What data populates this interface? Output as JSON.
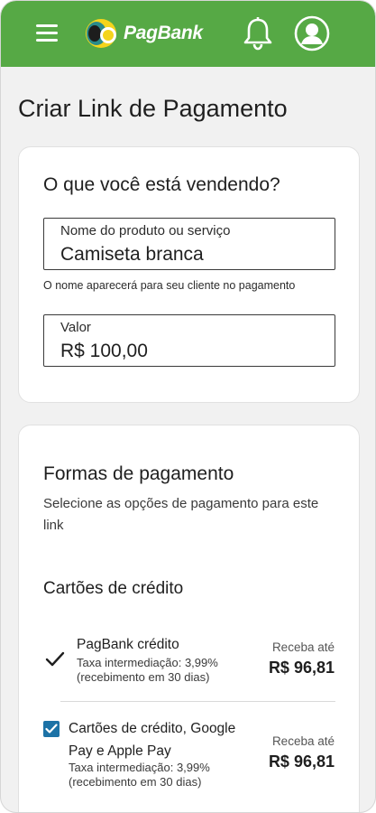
{
  "header": {
    "brand": "PagBank",
    "colors": {
      "bar": "#56a945",
      "logo_yellow": "#f4d41c",
      "logo_teal": "#2a8b8a"
    },
    "icons": {
      "menu": "hamburger-menu-icon",
      "notifications": "bell-icon",
      "profile": "user-avatar-icon"
    }
  },
  "page": {
    "title": "Criar Link de Pagamento"
  },
  "product": {
    "section_title": "O que você está vendendo?",
    "name_field": {
      "label": "Nome do produto ou serviço",
      "value": "Camiseta branca"
    },
    "name_helper": "O nome aparecerá para seu cliente no pagamento",
    "value_field": {
      "label": "Valor",
      "value": "R$ 100,00"
    }
  },
  "payment": {
    "section_title": "Formas de pagamento",
    "description": "Selecione as opções de pagamento para este link",
    "credit_title": "Cartões de crédito",
    "options": [
      {
        "name": "PagBank crédito",
        "fee_line1": "Taxa intermediação: 3,99%",
        "fee_line2": "(recebimento em 30 dias)",
        "receive_label": "Receba até",
        "receive_amount": "R$ 96,81",
        "selected": true,
        "control": "checkmark-icon"
      },
      {
        "name": "Cartões de crédito, Google Pay e Apple Pay",
        "fee_line1": "Taxa intermediação: 3,99%",
        "fee_line2": "(recebimento em 30 dias)",
        "receive_label": "Receba até",
        "receive_amount": "R$ 96,81",
        "selected": true,
        "control": "checkbox",
        "checkbox_color": "#1c72a6"
      }
    ]
  }
}
